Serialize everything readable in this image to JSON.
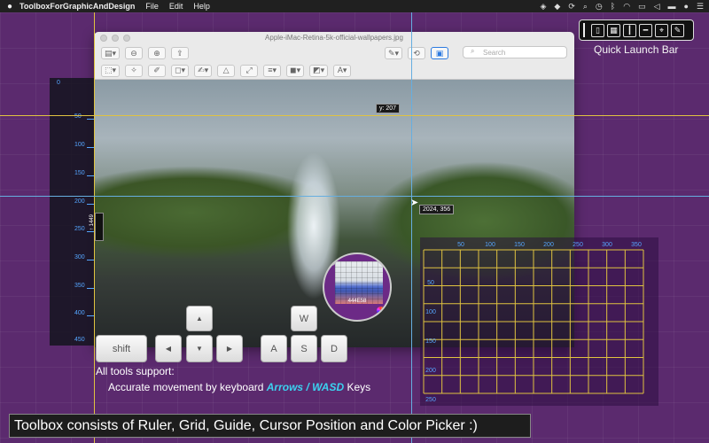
{
  "menubar": {
    "app_name": "ToolboxForGraphicAndDesign",
    "menus": [
      "File",
      "Edit",
      "Help"
    ]
  },
  "quick_launch": {
    "label": "Quick Launch Bar"
  },
  "window": {
    "title": "Apple-iMac-Retina-5k-official-wallpapers.jpg",
    "search_placeholder": "Search"
  },
  "ruler": {
    "ticks": [
      "0",
      "50",
      "100",
      "150",
      "200",
      "250",
      "300",
      "350",
      "400",
      "450"
    ],
    "tag": "↑ 1449"
  },
  "guides": {
    "y_label": "y: 207",
    "cursor_label": "2024, 356"
  },
  "grid_overlay": {
    "x_ticks": [
      "50",
      "100",
      "150",
      "200",
      "250",
      "300",
      "350"
    ],
    "y_ticks": [
      "50",
      "100",
      "150",
      "200",
      "250"
    ]
  },
  "color_picker": {
    "hex": "444E58"
  },
  "keys": {
    "shift": "shift",
    "up": "▲",
    "left": "◀",
    "down": "▼",
    "right": "▶",
    "w": "W",
    "a": "A",
    "s": "S",
    "d": "D"
  },
  "support": {
    "title": "All tools support:",
    "prefix": "Accurate movement by keyboard ",
    "accent": "Arrows / WASD",
    "suffix": " Keys"
  },
  "banner": "Toolbox consists of Ruler, Grid, Guide, Cursor Position and Color Picker :)"
}
